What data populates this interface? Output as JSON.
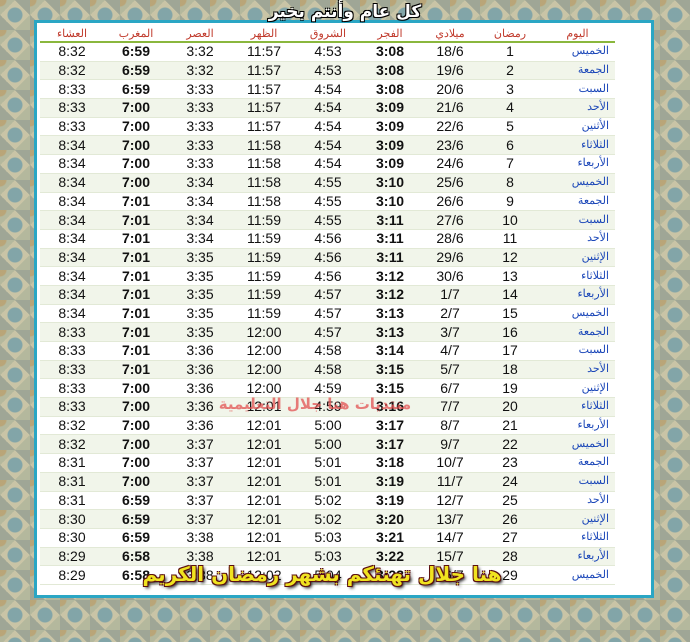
{
  "header_title": "كل عام وأنتم بخير",
  "columns": [
    "العشاء",
    "المغرب",
    "العصر",
    "الظهر",
    "الشروق",
    "الفجر",
    "ميلادي",
    "رمضان",
    "اليوم"
  ],
  "rows": [
    {
      "isha": "8:32",
      "maghrib": "6:59",
      "asr": "3:32",
      "dhuhr": "11:57",
      "sunrise": "4:53",
      "fajr": "3:08",
      "greg": "18/6",
      "ramadan": "1",
      "day": "الخميس"
    },
    {
      "isha": "8:32",
      "maghrib": "6:59",
      "asr": "3:32",
      "dhuhr": "11:57",
      "sunrise": "4:53",
      "fajr": "3:08",
      "greg": "19/6",
      "ramadan": "2",
      "day": "الجمعة"
    },
    {
      "isha": "8:33",
      "maghrib": "6:59",
      "asr": "3:33",
      "dhuhr": "11:57",
      "sunrise": "4:54",
      "fajr": "3:08",
      "greg": "20/6",
      "ramadan": "3",
      "day": "السبت"
    },
    {
      "isha": "8:33",
      "maghrib": "7:00",
      "asr": "3:33",
      "dhuhr": "11:57",
      "sunrise": "4:54",
      "fajr": "3:09",
      "greg": "21/6",
      "ramadan": "4",
      "day": "الأحد"
    },
    {
      "isha": "8:33",
      "maghrib": "7:00",
      "asr": "3:33",
      "dhuhr": "11:57",
      "sunrise": "4:54",
      "fajr": "3:09",
      "greg": "22/6",
      "ramadan": "5",
      "day": "الأثنين"
    },
    {
      "isha": "8:34",
      "maghrib": "7:00",
      "asr": "3:33",
      "dhuhr": "11:58",
      "sunrise": "4:54",
      "fajr": "3:09",
      "greg": "23/6",
      "ramadan": "6",
      "day": "الثلاثاء"
    },
    {
      "isha": "8:34",
      "maghrib": "7:00",
      "asr": "3:33",
      "dhuhr": "11:58",
      "sunrise": "4:54",
      "fajr": "3:09",
      "greg": "24/6",
      "ramadan": "7",
      "day": "الأربعاء"
    },
    {
      "isha": "8:34",
      "maghrib": "7:00",
      "asr": "3:34",
      "dhuhr": "11:58",
      "sunrise": "4:55",
      "fajr": "3:10",
      "greg": "25/6",
      "ramadan": "8",
      "day": "الخميس"
    },
    {
      "isha": "8:34",
      "maghrib": "7:01",
      "asr": "3:34",
      "dhuhr": "11:58",
      "sunrise": "4:55",
      "fajr": "3:10",
      "greg": "26/6",
      "ramadan": "9",
      "day": "الجمعة"
    },
    {
      "isha": "8:34",
      "maghrib": "7:01",
      "asr": "3:34",
      "dhuhr": "11:59",
      "sunrise": "4:55",
      "fajr": "3:11",
      "greg": "27/6",
      "ramadan": "10",
      "day": "السبت"
    },
    {
      "isha": "8:34",
      "maghrib": "7:01",
      "asr": "3:34",
      "dhuhr": "11:59",
      "sunrise": "4:56",
      "fajr": "3:11",
      "greg": "28/6",
      "ramadan": "11",
      "day": "الأحد"
    },
    {
      "isha": "8:34",
      "maghrib": "7:01",
      "asr": "3:35",
      "dhuhr": "11:59",
      "sunrise": "4:56",
      "fajr": "3:11",
      "greg": "29/6",
      "ramadan": "12",
      "day": "الإثنين"
    },
    {
      "isha": "8:34",
      "maghrib": "7:01",
      "asr": "3:35",
      "dhuhr": "11:59",
      "sunrise": "4:56",
      "fajr": "3:12",
      "greg": "30/6",
      "ramadan": "13",
      "day": "الثلاثاء"
    },
    {
      "isha": "8:34",
      "maghrib": "7:01",
      "asr": "3:35",
      "dhuhr": "11:59",
      "sunrise": "4:57",
      "fajr": "3:12",
      "greg": "1/7",
      "ramadan": "14",
      "day": "الأربعاء"
    },
    {
      "isha": "8:34",
      "maghrib": "7:01",
      "asr": "3:35",
      "dhuhr": "11:59",
      "sunrise": "4:57",
      "fajr": "3:13",
      "greg": "2/7",
      "ramadan": "15",
      "day": "الخميس"
    },
    {
      "isha": "8:33",
      "maghrib": "7:01",
      "asr": "3:35",
      "dhuhr": "12:00",
      "sunrise": "4:57",
      "fajr": "3:13",
      "greg": "3/7",
      "ramadan": "16",
      "day": "الجمعة"
    },
    {
      "isha": "8:33",
      "maghrib": "7:01",
      "asr": "3:36",
      "dhuhr": "12:00",
      "sunrise": "4:58",
      "fajr": "3:14",
      "greg": "4/7",
      "ramadan": "17",
      "day": "السبت"
    },
    {
      "isha": "8:33",
      "maghrib": "7:01",
      "asr": "3:36",
      "dhuhr": "12:00",
      "sunrise": "4:58",
      "fajr": "3:15",
      "greg": "5/7",
      "ramadan": "18",
      "day": "الأحد"
    },
    {
      "isha": "8:33",
      "maghrib": "7:00",
      "asr": "3:36",
      "dhuhr": "12:00",
      "sunrise": "4:59",
      "fajr": "3:15",
      "greg": "6/7",
      "ramadan": "19",
      "day": "الإثنين"
    },
    {
      "isha": "8:33",
      "maghrib": "7:00",
      "asr": "3:36",
      "dhuhr": "12:01",
      "sunrise": "4:59",
      "fajr": "3:16",
      "greg": "7/7",
      "ramadan": "20",
      "day": "الثلاثاء"
    },
    {
      "isha": "8:32",
      "maghrib": "7:00",
      "asr": "3:36",
      "dhuhr": "12:01",
      "sunrise": "5:00",
      "fajr": "3:17",
      "greg": "8/7",
      "ramadan": "21",
      "day": "الأربعاء"
    },
    {
      "isha": "8:32",
      "maghrib": "7:00",
      "asr": "3:37",
      "dhuhr": "12:01",
      "sunrise": "5:00",
      "fajr": "3:17",
      "greg": "9/7",
      "ramadan": "22",
      "day": "الخميس"
    },
    {
      "isha": "8:31",
      "maghrib": "7:00",
      "asr": "3:37",
      "dhuhr": "12:01",
      "sunrise": "5:01",
      "fajr": "3:18",
      "greg": "10/7",
      "ramadan": "23",
      "day": "الجمعة"
    },
    {
      "isha": "8:31",
      "maghrib": "7:00",
      "asr": "3:37",
      "dhuhr": "12:01",
      "sunrise": "5:01",
      "fajr": "3:19",
      "greg": "11/7",
      "ramadan": "24",
      "day": "السبت"
    },
    {
      "isha": "8:31",
      "maghrib": "6:59",
      "asr": "3:37",
      "dhuhr": "12:01",
      "sunrise": "5:02",
      "fajr": "3:19",
      "greg": "12/7",
      "ramadan": "25",
      "day": "الأحد"
    },
    {
      "isha": "8:30",
      "maghrib": "6:59",
      "asr": "3:37",
      "dhuhr": "12:01",
      "sunrise": "5:02",
      "fajr": "3:20",
      "greg": "13/7",
      "ramadan": "26",
      "day": "الإثنين"
    },
    {
      "isha": "8:30",
      "maghrib": "6:59",
      "asr": "3:38",
      "dhuhr": "12:01",
      "sunrise": "5:03",
      "fajr": "3:21",
      "greg": "14/7",
      "ramadan": "27",
      "day": "الثلاثاء"
    },
    {
      "isha": "8:29",
      "maghrib": "6:58",
      "asr": "3:38",
      "dhuhr": "12:01",
      "sunrise": "5:03",
      "fajr": "3:22",
      "greg": "15/7",
      "ramadan": "28",
      "day": "الأربعاء"
    },
    {
      "isha": "8:29",
      "maghrib": "6:58",
      "asr": "3:38",
      "dhuhr": "12:02",
      "sunrise": "5:04",
      "fajr": "3:23",
      "greg": "16/7",
      "ramadan": "29",
      "day": "الخميس"
    }
  ],
  "watermark": "منتديات هنا جلال التعليمية",
  "footer": "هنا جلال تهنئكم بشهر رمضان الكريم"
}
